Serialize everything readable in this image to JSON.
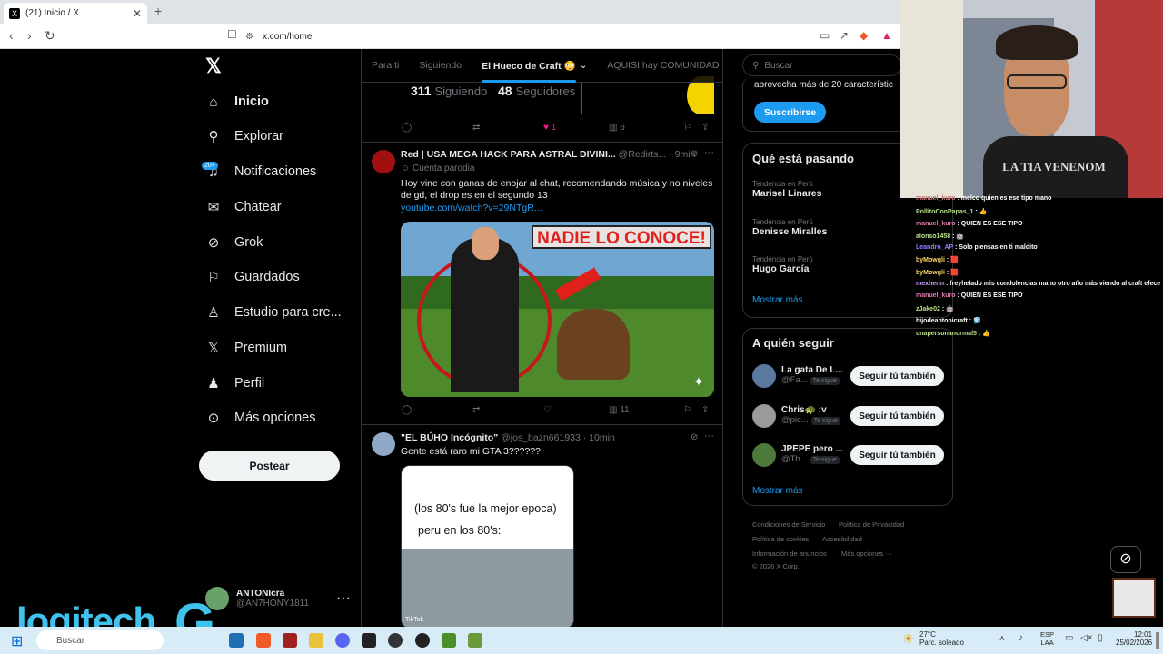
{
  "browser": {
    "tab_title": "(21) Inicio / X",
    "new_tab": "+",
    "url": "x.com/home"
  },
  "sidebar": {
    "items": [
      {
        "label": "Inicio",
        "icon": "home-icon"
      },
      {
        "label": "Explorar",
        "icon": "search-icon"
      },
      {
        "label": "Notificaciones",
        "icon": "bell-icon"
      },
      {
        "label": "Chatear",
        "icon": "mail-icon"
      },
      {
        "label": "Grok",
        "icon": "grok-icon"
      },
      {
        "label": "Guardados",
        "icon": "bookmark-icon"
      },
      {
        "label": "Estudio para cre...",
        "icon": "studio-icon"
      },
      {
        "label": "Premium",
        "icon": "x-premium-icon"
      },
      {
        "label": "Perfil",
        "icon": "person-icon"
      },
      {
        "label": "Más opciones",
        "icon": "more-circle-icon"
      }
    ],
    "notif_badge": "20+",
    "post_button": "Postear",
    "account": {
      "name": "ANTONIcra",
      "handle": "@AN7HONY1811"
    }
  },
  "feed": {
    "tabs": [
      "Para ti",
      "Siguiendo",
      "El Hueco de Craft 😳",
      "AQUISI hay COMUNIDAD"
    ],
    "selected_tab": "El Hueco de Craft 😳",
    "top_stats": {
      "following": "311",
      "following_label": "Siguiendo",
      "followers": "48",
      "followers_label": "Seguidores"
    },
    "top_actions": {
      "likes": "1",
      "views": "6"
    },
    "tweet1": {
      "name": "Red | USA MEGA HACK PARA ASTRAL DIVINI...",
      "handle": "@Redirts...",
      "time": "· 9min",
      "parody": "Cuenta parodia",
      "text": "Hoy vine con ganas de enojar al chat, recomendando música y no niveles de gd, el drop es en el segundo 13",
      "link": "youtube.com/watch?v=29NTgR...",
      "thumb_text": "NADIE LO CONOCE!",
      "views": "11"
    },
    "tweet2": {
      "name": "\"EL BÚHO Incógnito\"",
      "handle": "@jos_bazn661933",
      "time": "· 10min",
      "text": "Gente está raro mi GTA 3??????",
      "image_text_1": "(los 80's fue la mejor epoca)",
      "image_text_2": "peru en los 80's:",
      "image_watermark": "TikTok"
    }
  },
  "right": {
    "search_placeholder": "Buscar",
    "premium_text": "aprovecha más de 20 característic",
    "subscribe": "Suscribirse",
    "trends_title": "Qué está pasando",
    "trends": [
      {
        "label": "Tendencia en Perú",
        "name": "Marisel Linares"
      },
      {
        "label": "Tendencia en Perú",
        "name": "Denisse Miralles"
      },
      {
        "label": "Tendencia en Perú",
        "name": "Hugo García"
      }
    ],
    "show_more": "Mostrar más",
    "follow_title": "A quién seguir",
    "follow": [
      {
        "name": "La gata De L...",
        "handle": "@Fa...",
        "tag": "Te sigue",
        "button": "Seguir tú también"
      },
      {
        "name": "Chris🐢 :v",
        "handle": "@pic...",
        "tag": "Te sigue",
        "button": "Seguir tú también"
      },
      {
        "name": "JPEPE pero ...",
        "handle": "@Th...",
        "tag": "Te sigue",
        "button": "Seguir tú también"
      }
    ],
    "follow_more": "Mostrar más",
    "footer": [
      "Condiciones de Servicio",
      "Política de Privacidad",
      "Política de cookies",
      "Accesibilidad",
      "Información de anuncios",
      "Más opciones ···",
      "© 2026 X Corp."
    ]
  },
  "chat": [
    {
      "user": "manuel_kuro",
      "msg": ": melco quien es ese tipo mano"
    },
    {
      "user": "PollitoConPapas_1",
      "msg": ": 👍"
    },
    {
      "user": "manuel_kuro",
      "msg": ": QUIEN ES ESE TIPO"
    },
    {
      "user": "alonso1458",
      "msg": ": 🤖"
    },
    {
      "user": "Leandro_AP",
      "msg": ": Solo piensas en ti maldito"
    },
    {
      "user": "byMowgli",
      "msg": ": 🟥"
    },
    {
      "user": "byMowgli",
      "msg": ": 🟥"
    },
    {
      "user": "mexherin",
      "msg": ": freyhelado mis condolencias mano otro año más viendo al craft efece"
    },
    {
      "user": "manuel_kuro",
      "msg": ": QUIEN ES ESE TIPO"
    },
    {
      "user": "zJake02",
      "msg": ": 🤖"
    },
    {
      "user": "hijodeantonicraft",
      "msg": ": 🧊"
    },
    {
      "user": "unapersonanormal5",
      "msg": ": 👍"
    }
  ],
  "overlay": {
    "webcam_shirt": "LA TIA VENENOM",
    "brand": "logitech"
  },
  "taskbar": {
    "search": "Buscar",
    "weather_temp": "27°C",
    "weather_desc": "Parc. soleado",
    "lang_1": "ESP",
    "lang_2": "LAA",
    "time": "12:01",
    "date": "25/02/2026"
  }
}
